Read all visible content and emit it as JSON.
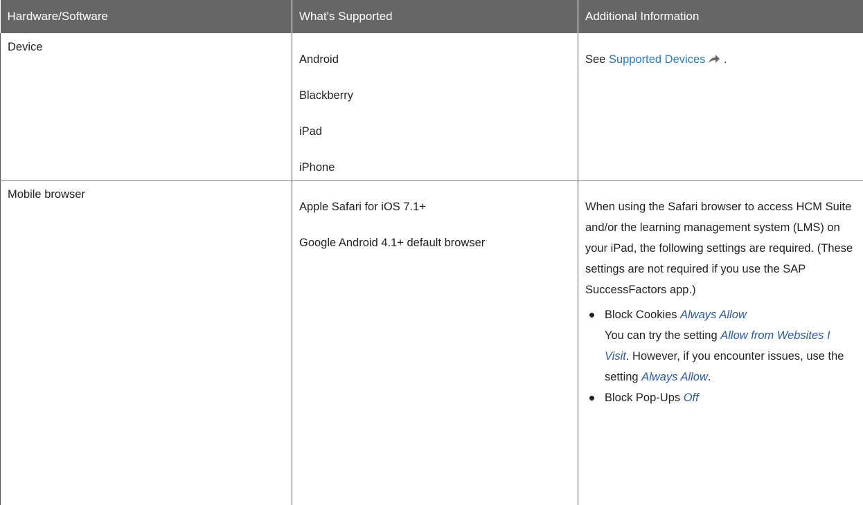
{
  "table": {
    "headers": [
      "Hardware/Software",
      "What's Supported",
      "Additional Information"
    ],
    "rows": [
      {
        "hardware": "Device",
        "supported": [
          "Android",
          "Blackberry",
          "iPad",
          "iPhone"
        ],
        "info": {
          "prefix": "See ",
          "link_text": "Supported Devices",
          "suffix": " .",
          "icon": "external-link-icon"
        }
      },
      {
        "hardware": "Mobile browser",
        "supported": [
          "Apple Safari for iOS 7.1+",
          "Google Android 4.1+ default browser"
        ],
        "info": {
          "paragraph": "When using the Safari browser to access HCM Suite and/or the learning management system (LMS) on your iPad, the following settings are required. (These settings are not required if you use the SAP SuccessFactors app.)",
          "bullets": [
            {
              "label": "Block Cookies ",
              "value": "Always Allow",
              "note_prefix": "You can try the setting ",
              "note_em1": "Allow from Websites I Visit",
              "note_mid": ". However, if you encounter issues, use the setting ",
              "note_em2": "Always Allow",
              "note_end": "."
            },
            {
              "label": "Block Pop-Ups ",
              "value": "Off"
            }
          ]
        }
      }
    ]
  },
  "colors": {
    "header_bg": "#666666",
    "link": "#2a7ab8",
    "emphasis": "#2a5a9c"
  }
}
